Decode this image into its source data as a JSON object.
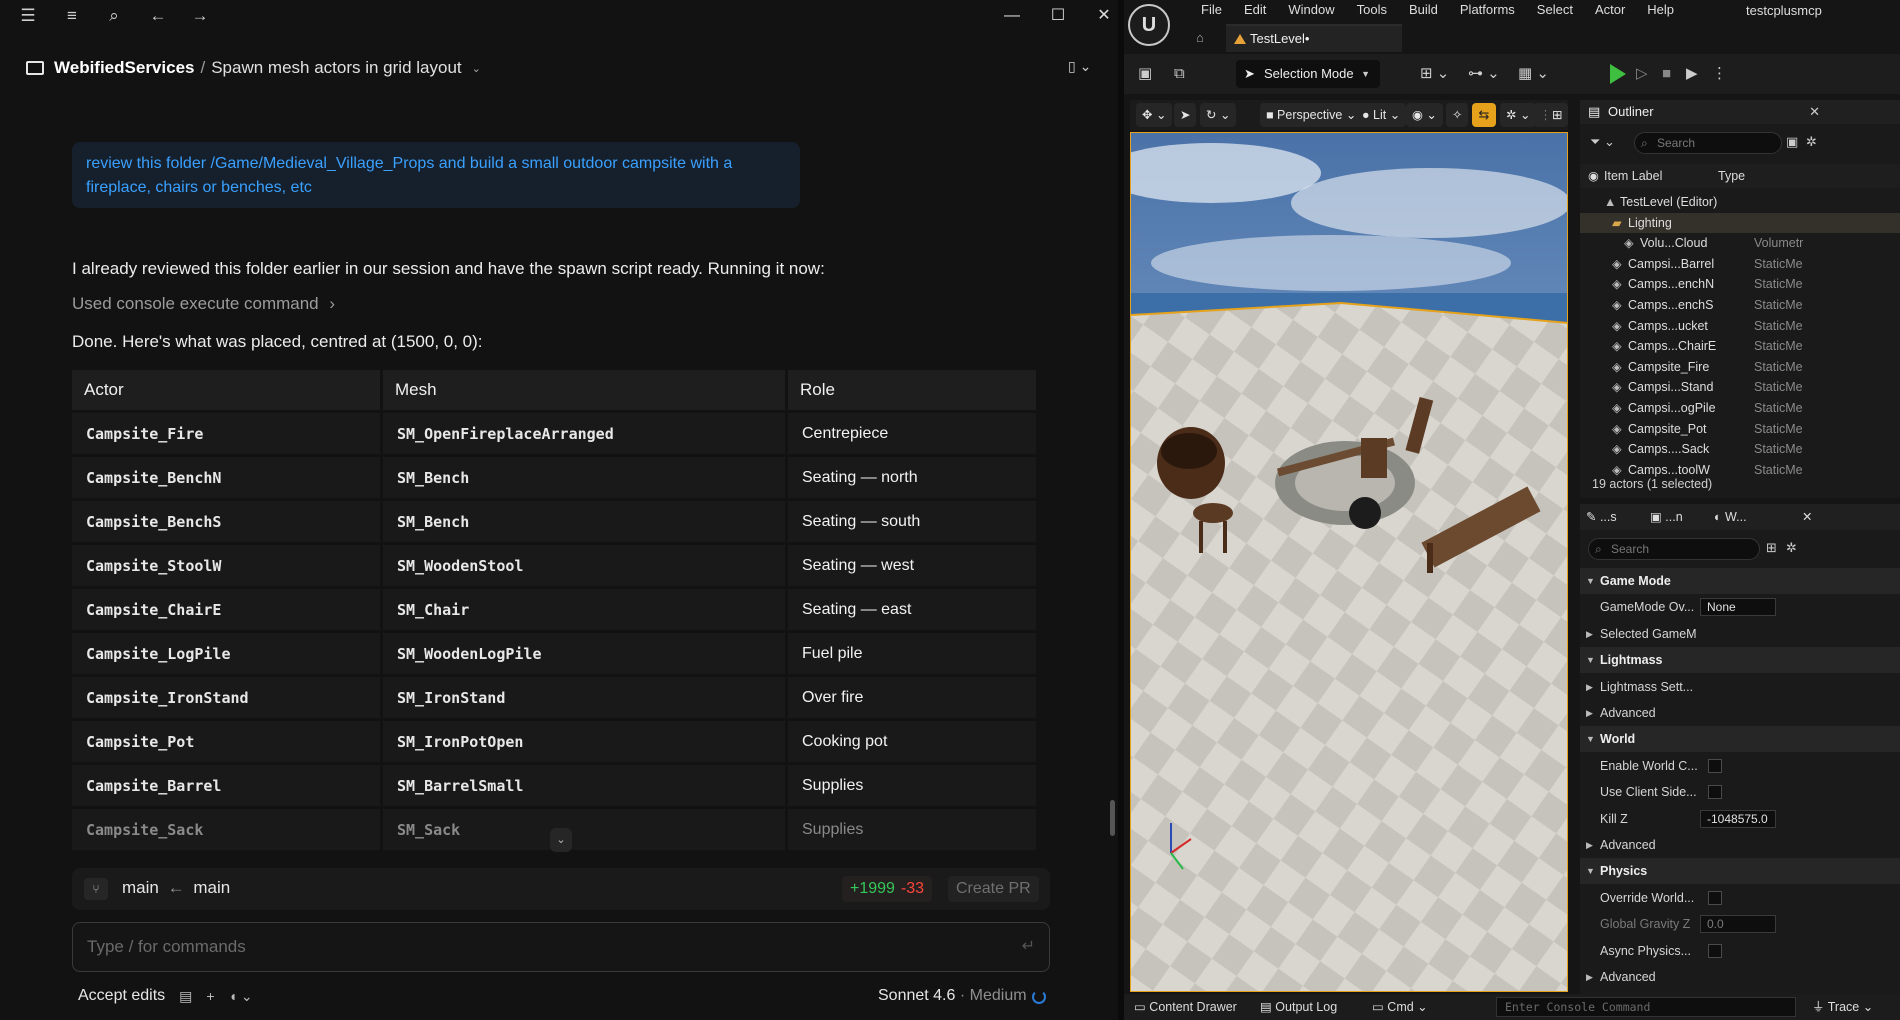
{
  "chat": {
    "breadcrumb": {
      "project": "WebifiedServices",
      "separator": "/",
      "title": "Spawn mesh actors in grid layout"
    },
    "user_message": "review this folder /Game/Medieval_Village_Props and build a small outdoor campsite with a fireplace, chairs or benches, etc",
    "reply_intro": "I already reviewed this folder earlier in our session and have the spawn script ready. Running it now:",
    "tool_call": "Used console execute command",
    "tool_chevron": "›",
    "done_text": "Done. Here's what was placed, centred at (1500, 0, 0):",
    "table": {
      "headers": [
        "Actor",
        "Mesh",
        "Role"
      ],
      "rows": [
        [
          "Campsite_Fire",
          "SM_OpenFireplaceArranged",
          "Centrepiece"
        ],
        [
          "Campsite_BenchN",
          "SM_Bench",
          "Seating — north"
        ],
        [
          "Campsite_BenchS",
          "SM_Bench",
          "Seating — south"
        ],
        [
          "Campsite_StoolW",
          "SM_WoodenStool",
          "Seating — west"
        ],
        [
          "Campsite_ChairE",
          "SM_Chair",
          "Seating — east"
        ],
        [
          "Campsite_LogPile",
          "SM_WoodenLogPile",
          "Fuel pile"
        ],
        [
          "Campsite_IronStand",
          "SM_IronStand",
          "Over fire"
        ],
        [
          "Campsite_Pot",
          "SM_IronPotOpen",
          "Cooking pot"
        ],
        [
          "Campsite_Barrel",
          "SM_BarrelSmall",
          "Supplies"
        ],
        [
          "Campsite_Sack",
          "SM_Sack",
          "Supplies"
        ]
      ]
    },
    "branch": {
      "from": "main",
      "arrow": "←",
      "to": "main",
      "additions": "+1999",
      "deletions": "-33",
      "create_pr": "Create PR"
    },
    "input_placeholder": "Type / for commands",
    "accept_edits": "Accept edits",
    "model": "Sonnet 4.6",
    "effort": "· Medium"
  },
  "ue": {
    "logo": "U",
    "menu": [
      "File",
      "Edit",
      "Window",
      "Tools",
      "Build",
      "Platforms",
      "Select",
      "Actor",
      "Help"
    ],
    "project": "testcplusmcp",
    "level_tab": "TestLevel•",
    "selection_mode": "Selection Mode",
    "viewport": {
      "perspective": "Perspective",
      "lit": "Lit"
    },
    "outliner": {
      "title": "Outliner",
      "search": "Search",
      "col_label": "Item Label",
      "col_type": "Type",
      "rows": [
        {
          "label": "TestLevel (Editor)",
          "type": ""
        },
        {
          "label": "Lighting",
          "type": ""
        },
        {
          "label": "Volu...Cloud",
          "type": "Volumetr"
        },
        {
          "label": "Campsi...Barrel",
          "type": "StaticMe"
        },
        {
          "label": "Camps...enchN",
          "type": "StaticMe"
        },
        {
          "label": "Camps...enchS",
          "type": "StaticMe"
        },
        {
          "label": "Camps...ucket",
          "type": "StaticMe"
        },
        {
          "label": "Camps...ChairE",
          "type": "StaticMe"
        },
        {
          "label": "Campsite_Fire",
          "type": "StaticMe"
        },
        {
          "label": "Campsi...Stand",
          "type": "StaticMe"
        },
        {
          "label": "Campsi...ogPile",
          "type": "StaticMe"
        },
        {
          "label": "Campsite_Pot",
          "type": "StaticMe"
        },
        {
          "label": "Camps....Sack",
          "type": "StaticMe"
        },
        {
          "label": "Camps...toolW",
          "type": "StaticMe"
        }
      ],
      "footer": "19 actors (1 selected)"
    },
    "details": {
      "tabs": [
        "...s",
        "...n",
        "W..."
      ],
      "search": "Search",
      "rows": [
        {
          "kind": "section",
          "name": "Game Mode"
        },
        {
          "kind": "value",
          "name": "GameMode Ov...",
          "value": "None"
        },
        {
          "kind": "sub",
          "name": "Selected GameM"
        },
        {
          "kind": "section",
          "name": "Lightmass"
        },
        {
          "kind": "sub",
          "name": "Lightmass Sett..."
        },
        {
          "kind": "sub",
          "name": "Advanced"
        },
        {
          "kind": "section",
          "name": "World"
        },
        {
          "kind": "check",
          "name": "Enable World C..."
        },
        {
          "kind": "check",
          "name": "Use Client Side..."
        },
        {
          "kind": "value",
          "name": "Kill Z",
          "value": "-1048575.0"
        },
        {
          "kind": "sub",
          "name": "Advanced"
        },
        {
          "kind": "section",
          "name": "Physics"
        },
        {
          "kind": "check",
          "name": "Override World..."
        },
        {
          "kind": "value-dim",
          "name": "Global Gravity Z",
          "value": "0.0"
        },
        {
          "kind": "check",
          "name": "Async Physics..."
        },
        {
          "kind": "sub",
          "name": "Advanced"
        }
      ]
    },
    "bottom": {
      "content_drawer": "Content Drawer",
      "output_log": "Output Log",
      "cmd": "Cmd",
      "console_placeholder": "Enter Console Command",
      "trace": "Trace"
    },
    "colors": {
      "accent": "#e5a21a",
      "play": "#3fbf3f",
      "link": "#3aa0ff",
      "add": "#34c759",
      "del": "#ff453a"
    }
  }
}
